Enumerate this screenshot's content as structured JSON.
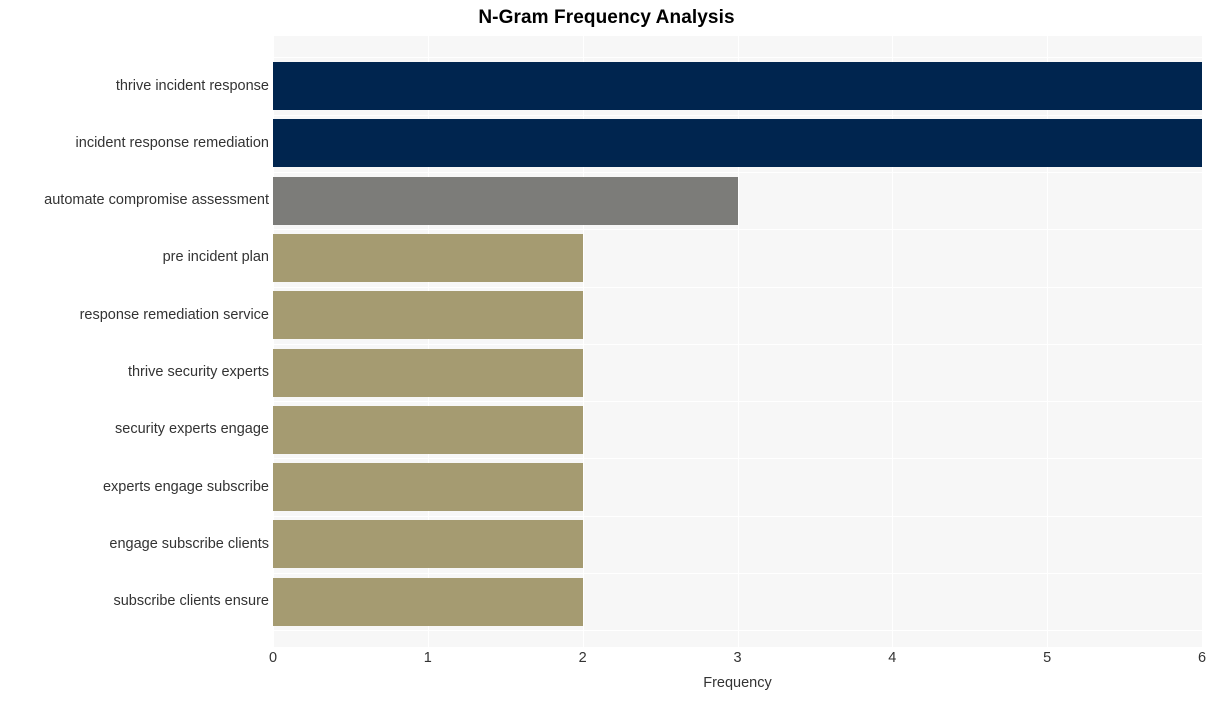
{
  "chart_data": {
    "type": "bar",
    "orientation": "horizontal",
    "title": "N-Gram Frequency Analysis",
    "xlabel": "Frequency",
    "ylabel": "",
    "xlim": [
      0,
      6
    ],
    "xticks": [
      0,
      1,
      2,
      3,
      4,
      5,
      6
    ],
    "xtick_labels": [
      "0",
      "1",
      "2",
      "3",
      "4",
      "5",
      "6"
    ],
    "grid": true,
    "legend": false,
    "categories": [
      "thrive incident response",
      "incident response remediation",
      "automate compromise assessment",
      "pre incident plan",
      "response remediation service",
      "thrive security experts",
      "security experts engage",
      "experts engage subscribe",
      "engage subscribe clients",
      "subscribe clients ensure"
    ],
    "values": [
      6,
      6,
      3,
      2,
      2,
      2,
      2,
      2,
      2,
      2
    ],
    "bar_colors": [
      "#00254f",
      "#00254f",
      "#7c7c79",
      "#a59b71",
      "#a59b71",
      "#a59b71",
      "#a59b71",
      "#a59b71",
      "#a59b71",
      "#a59b71"
    ],
    "bars": [
      {
        "label": "thrive incident response",
        "value": 6,
        "color": "#00254f"
      },
      {
        "label": "incident response remediation",
        "value": 6,
        "color": "#00254f"
      },
      {
        "label": "automate compromise assessment",
        "value": 3,
        "color": "#7c7c79"
      },
      {
        "label": "pre incident plan",
        "value": 2,
        "color": "#a59b71"
      },
      {
        "label": "response remediation service",
        "value": 2,
        "color": "#a59b71"
      },
      {
        "label": "thrive security experts",
        "value": 2,
        "color": "#a59b71"
      },
      {
        "label": "security experts engage",
        "value": 2,
        "color": "#a59b71"
      },
      {
        "label": "experts engage subscribe",
        "value": 2,
        "color": "#a59b71"
      },
      {
        "label": "engage subscribe clients",
        "value": 2,
        "color": "#a59b71"
      },
      {
        "label": "subscribe clients ensure",
        "value": 2,
        "color": "#a59b71"
      }
    ]
  },
  "style": {
    "plot_background": "#f7f7f7",
    "figure_background": "#ffffff",
    "grid_color": "#ffffff",
    "text_color": "#333333",
    "title_color": "#000000"
  }
}
